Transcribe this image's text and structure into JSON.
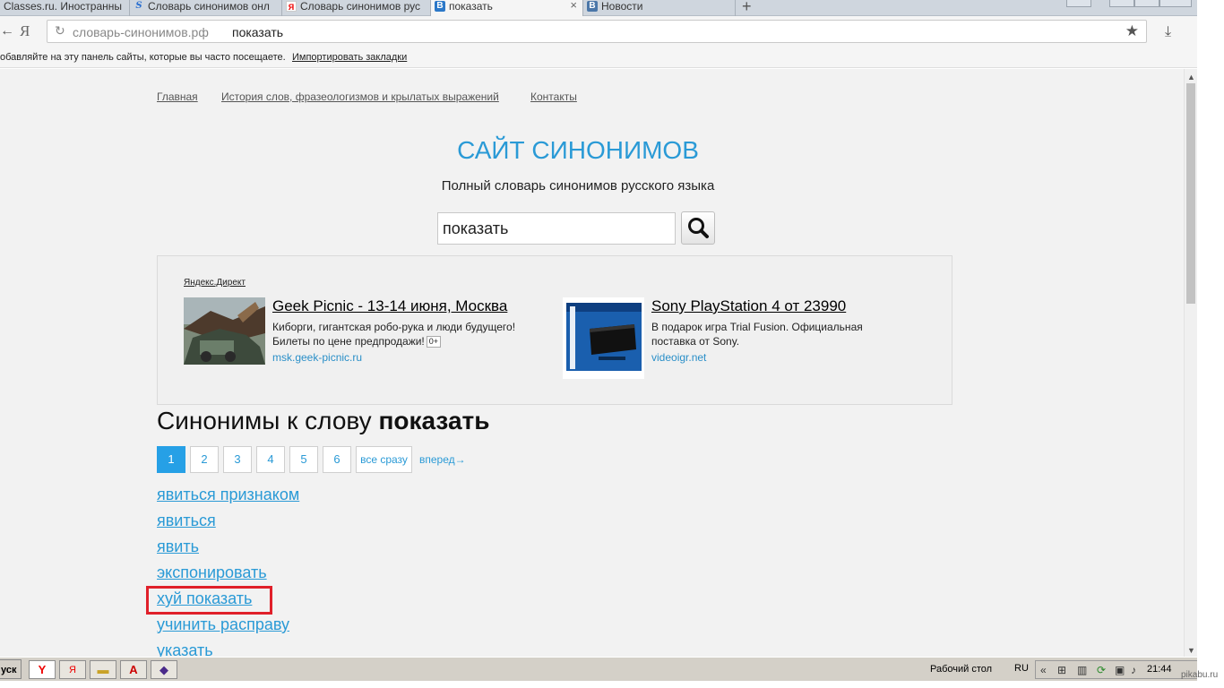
{
  "browser": {
    "tabs": [
      {
        "title": "Classes.ru. Иностранны",
        "icon": "blank-icon"
      },
      {
        "title": "Словарь синонимов онл",
        "icon": "s-icon"
      },
      {
        "title": "Словарь синонимов рус",
        "icon": "yandex-icon"
      },
      {
        "title": "показать",
        "icon": "b-icon",
        "active": true
      },
      {
        "title": "Новости",
        "icon": "vk-icon"
      }
    ],
    "new_tab": "+",
    "back_arrow": "←",
    "logo": "Я",
    "url_host": "словарь-синонимов.рф",
    "url_query": "показать",
    "bookmarks_hint": "обавляйте на эту панель сайты, которые вы часто посещаете.",
    "bookmarks_import": "Импортировать закладки"
  },
  "page": {
    "nav": [
      "Главная",
      "История слов, фразеологизмов и крылатых выражений",
      "Контакты"
    ],
    "site_title": "САЙТ СИНОНИМОВ",
    "site_subtitle": "Полный словарь синонимов русского языка",
    "search_value": "показать",
    "ads": {
      "label": "Яндекс.Директ",
      "items": [
        {
          "title": "Geek Picnic - 13-14 июня, Москва",
          "desc1": "Киборги, гигантская робо-рука и люди будущего!",
          "desc2": "Билеты по цене предпродажи!",
          "age": "0+",
          "url": "msk.geek-picnic.ru"
        },
        {
          "title": "Sony PlayStation 4 от 23990",
          "desc1": "В подарок игра Trial Fusion. Официальная",
          "desc2": "поставка от Sony.",
          "url": "videoigr.net"
        }
      ]
    },
    "heading_prefix": "Синонимы к слову",
    "heading_word": "показать",
    "pager": {
      "pages": [
        "1",
        "2",
        "3",
        "4",
        "5",
        "6"
      ],
      "all": "все сразу",
      "next": "вперед→"
    },
    "synonyms": [
      "явиться признаком",
      "явиться",
      "явить",
      "экспонировать",
      "хуй показать",
      "учинить расправу",
      "указать"
    ]
  },
  "taskbar": {
    "start": "уск",
    "desktop": "Рабочий стол",
    "lang": "RU",
    "clock": "21:44"
  },
  "watermark": "pikabu.ru",
  "colors": {
    "accent": "#2a9ad6",
    "pager_active": "#26a0e6",
    "highlight": "#e0202a"
  }
}
